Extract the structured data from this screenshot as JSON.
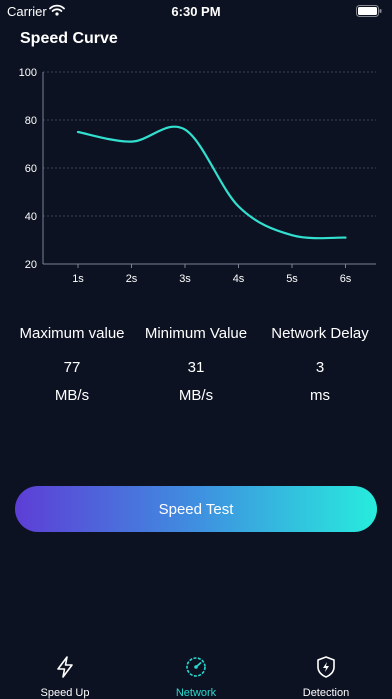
{
  "status_bar": {
    "carrier": "Carrier",
    "time": "6:30 PM"
  },
  "title": "Speed Curve",
  "chart_data": {
    "type": "line",
    "x": [
      "1s",
      "2s",
      "3s",
      "4s",
      "5s",
      "6s"
    ],
    "y_ticks": [
      "100",
      "80",
      "60",
      "40",
      "20"
    ],
    "ylim": [
      20,
      100
    ],
    "series": [
      {
        "values": [
          75,
          71,
          76,
          44,
          32,
          31
        ]
      }
    ],
    "color": "#32e0cf",
    "grid": true
  },
  "stats": {
    "max": {
      "label": "Maximum value",
      "value": "77",
      "unit": "MB/s"
    },
    "min": {
      "label": "Minimum Value",
      "value": "31",
      "unit": "MB/s"
    },
    "delay": {
      "label": "Network Delay",
      "value": "3",
      "unit": "ms"
    }
  },
  "button": {
    "label": "Speed Test"
  },
  "tabs": [
    {
      "label": "Speed Up",
      "icon": "bolt-icon"
    },
    {
      "label": "Network",
      "icon": "speedometer-icon",
      "active": true
    },
    {
      "label": "Detection",
      "icon": "shield-bolt-icon"
    }
  ],
  "colors": {
    "background": "#0d1222",
    "accent": "#29d9cf"
  }
}
